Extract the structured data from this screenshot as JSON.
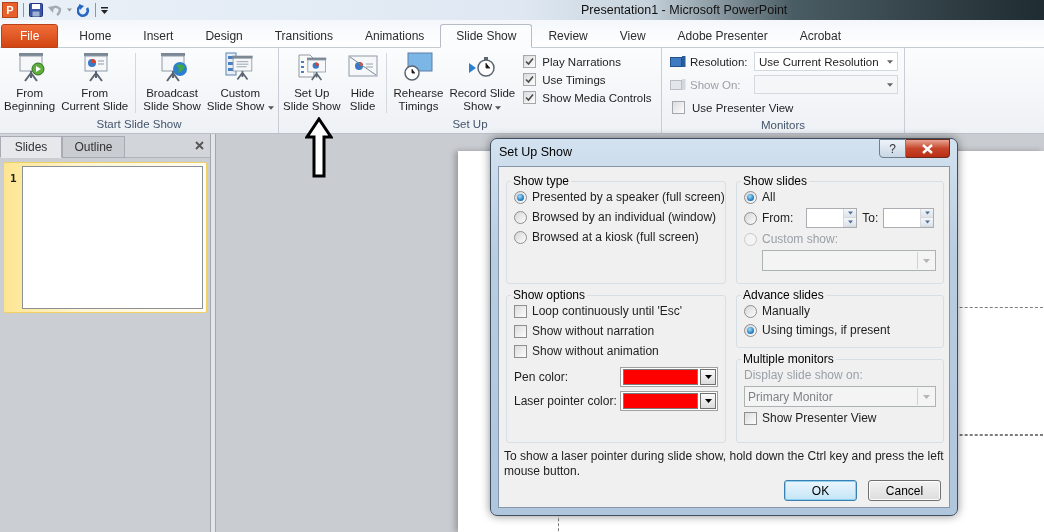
{
  "title_bar": {
    "app_icon": "P",
    "title": "Presentation1  -  Microsoft PowerPoint"
  },
  "tabs": [
    {
      "label": "File",
      "kind": "file",
      "selected": false
    },
    {
      "label": "Home",
      "kind": "tab",
      "selected": false
    },
    {
      "label": "Insert",
      "kind": "tab",
      "selected": false
    },
    {
      "label": "Design",
      "kind": "tab",
      "selected": false
    },
    {
      "label": "Transitions",
      "kind": "tab",
      "selected": false
    },
    {
      "label": "Animations",
      "kind": "tab",
      "selected": false
    },
    {
      "label": "Slide Show",
      "kind": "tab",
      "selected": true
    },
    {
      "label": "Review",
      "kind": "tab",
      "selected": false
    },
    {
      "label": "View",
      "kind": "tab",
      "selected": false
    },
    {
      "label": "Adobe Presenter",
      "kind": "tab",
      "selected": false
    },
    {
      "label": "Acrobat",
      "kind": "tab",
      "selected": false
    }
  ],
  "ribbon": {
    "groups": [
      {
        "label": "Start Slide Show",
        "items": [
          {
            "kind": "large",
            "lines": [
              "From",
              "Beginning"
            ],
            "dropdown": false
          },
          {
            "kind": "large",
            "lines": [
              "From",
              "Current Slide"
            ],
            "dropdown": false
          },
          {
            "kind": "separator"
          },
          {
            "kind": "large",
            "lines": [
              "Broadcast",
              "Slide Show"
            ],
            "dropdown": false
          },
          {
            "kind": "large",
            "lines": [
              "Custom",
              "Slide Show"
            ],
            "dropdown": true
          }
        ]
      },
      {
        "label": "Set Up",
        "items": [
          {
            "kind": "large",
            "lines": [
              "Set Up",
              "Slide Show"
            ],
            "dropdown": false
          },
          {
            "kind": "large",
            "lines": [
              "Hide",
              "Slide"
            ],
            "dropdown": false
          },
          {
            "kind": "separator"
          },
          {
            "kind": "large",
            "lines": [
              "Rehearse",
              "Timings"
            ],
            "dropdown": false
          },
          {
            "kind": "large",
            "lines": [
              "Record Slide",
              "Show"
            ],
            "dropdown": true
          },
          {
            "kind": "checks",
            "checks": [
              {
                "label": "Play Narrations",
                "checked": true
              },
              {
                "label": "Use Timings",
                "checked": true
              },
              {
                "label": "Show Media Controls",
                "checked": true
              }
            ]
          }
        ]
      },
      {
        "label": "Monitors",
        "items": [
          {
            "kind": "settings",
            "rows": [
              {
                "kind": "select",
                "label": "Resolution:",
                "value": "Use Current Resolution",
                "disabled": false
              },
              {
                "kind": "select",
                "label": "Show On:",
                "disabled": true
              },
              {
                "kind": "check",
                "label": "Use Presenter View",
                "checked": false
              }
            ]
          }
        ]
      }
    ]
  },
  "slides_pane": {
    "tabs": [
      {
        "label": "Slides",
        "selected": true
      },
      {
        "label": "Outline",
        "selected": false
      }
    ],
    "slides": [
      {
        "number": "1",
        "selected": true
      }
    ]
  },
  "dialog": {
    "title": "Set Up Show",
    "help": "?",
    "show_type": {
      "title": "Show type",
      "options": [
        {
          "label": "Presented by a speaker (full screen)",
          "selected": true
        },
        {
          "label": "Browsed by an individual (window)",
          "selected": false
        },
        {
          "label": "Browsed at a kiosk (full screen)",
          "selected": false
        }
      ]
    },
    "show_slides": {
      "title": "Show slides",
      "options": [
        {
          "kind": "all",
          "label": "All",
          "selected": true,
          "disabled": false
        },
        {
          "kind": "range",
          "label": "From:",
          "to_label": "To:",
          "selected": false,
          "disabled": false
        },
        {
          "kind": "custom",
          "label": "Custom show:",
          "selected": false,
          "disabled": true
        }
      ]
    },
    "show_options": {
      "title": "Show options",
      "checks": [
        {
          "label": "Loop continuously until 'Esc'",
          "checked": false
        },
        {
          "label": "Show without narration",
          "checked": false
        },
        {
          "label": "Show without animation",
          "checked": false
        }
      ],
      "colors": [
        {
          "label": "Pen color:",
          "color": "#ff0000"
        },
        {
          "label": "Laser pointer color:",
          "color": "#ff0000"
        }
      ]
    },
    "advance_slides": {
      "title": "Advance slides",
      "options": [
        {
          "label": "Manually",
          "selected": false
        },
        {
          "label": "Using timings, if present",
          "selected": true
        }
      ]
    },
    "multiple_monitors": {
      "title": "Multiple monitors",
      "label": "Display slide show on:",
      "value": "Primary Monitor",
      "disabled": true,
      "checks": [
        {
          "label": "Show Presenter View",
          "checked": false
        }
      ]
    },
    "note": "To show a laser pointer during slide show, hold down the Ctrl key and press the left mouse button.",
    "buttons": [
      {
        "label": "OK",
        "default": true
      },
      {
        "label": "Cancel",
        "default": false
      }
    ]
  }
}
